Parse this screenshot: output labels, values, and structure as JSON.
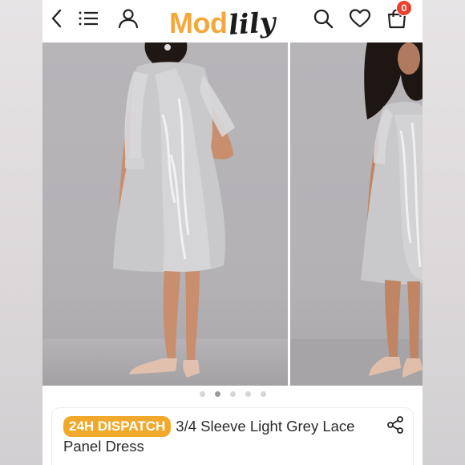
{
  "header": {
    "logo_part1": "Mod",
    "logo_part2": "lily",
    "cart_count": "0",
    "icons": [
      "back-chevron-icon",
      "menu-icon",
      "user-icon",
      "search-icon",
      "heart-icon",
      "cart-icon"
    ]
  },
  "gallery": {
    "slide_count": 5,
    "active_index": 1
  },
  "product": {
    "badge": "24H DISPATCH",
    "title": "3/4 Sleeve Light Grey Lace Panel Dress",
    "share_icon": "share-icon"
  },
  "colors": {
    "brand_orange": "#f4a83a",
    "badge_orange": "#f1a92c",
    "cart_badge_red": "#e8402f"
  }
}
